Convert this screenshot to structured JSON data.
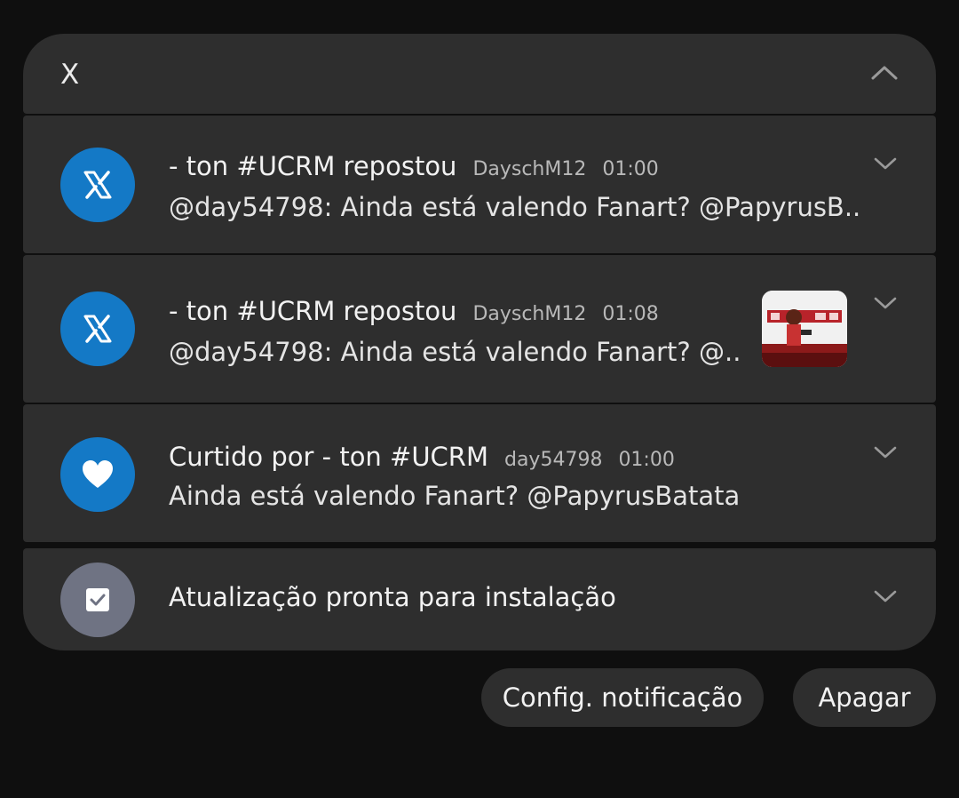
{
  "group": {
    "app_name": "X"
  },
  "notifications": [
    {
      "title": "- ton #UCRM repostou",
      "account": "DayschM12",
      "time": "01:00",
      "body": "@day54798: Ainda está valendo Fanart? @PapyrusB..",
      "icon": "x-logo-icon",
      "has_thumbnail": false
    },
    {
      "title": "- ton #UCRM repostou",
      "account": "DayschM12",
      "time": "01:08",
      "body": "@day54798: Ainda está valendo Fanart? @..",
      "icon": "x-logo-icon",
      "has_thumbnail": true
    },
    {
      "title": "Curtido por - ton #UCRM",
      "account": "day54798",
      "time": "01:00",
      "body": "Ainda está valendo Fanart? @PapyrusBatata",
      "icon": "heart-icon",
      "has_thumbnail": false
    },
    {
      "title": "Atualização pronta para instalação",
      "icon": "checkbox-update-icon"
    }
  ],
  "actions": {
    "settings_label": "Config. notificação",
    "clear_label": "Apagar"
  },
  "colors": {
    "background": "#0f0f0f",
    "card": "#2e2e2e",
    "x_blue": "#1479c6",
    "system_gray": "#6f7383"
  }
}
